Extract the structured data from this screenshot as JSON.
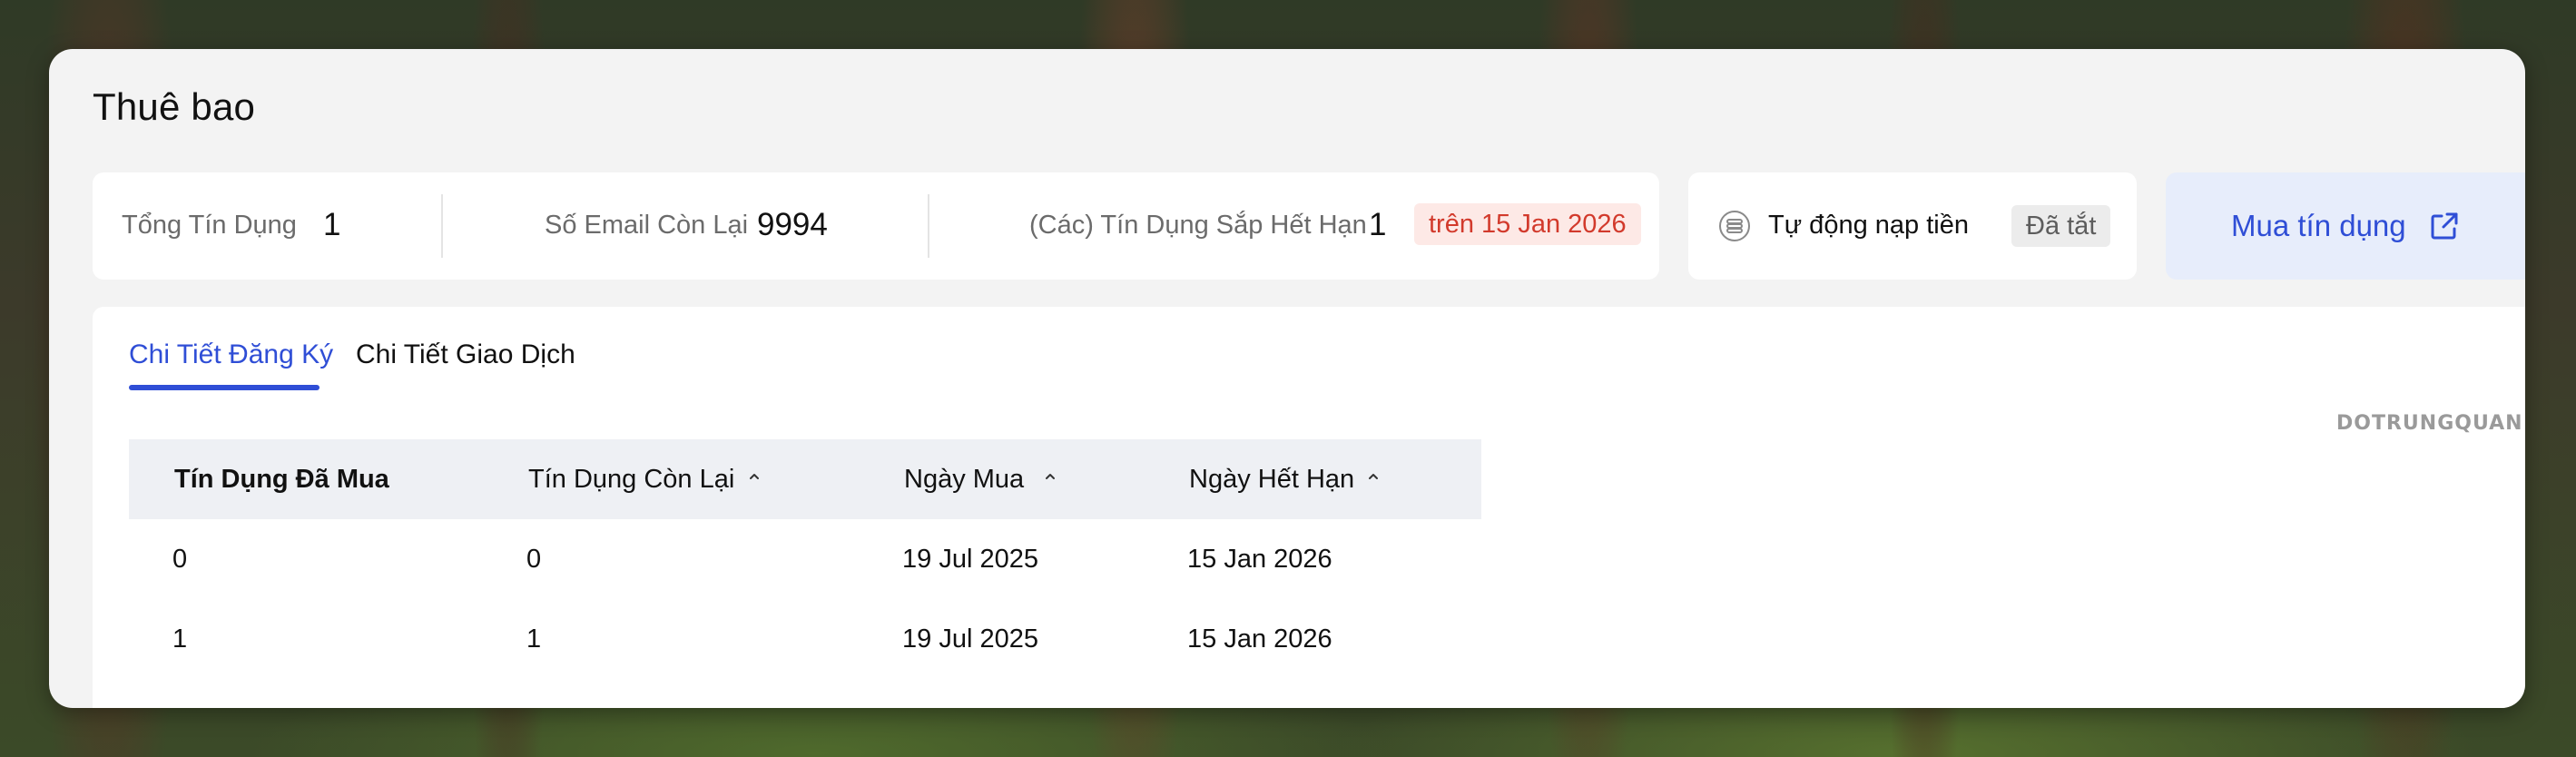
{
  "page": {
    "title": "Thuê bao"
  },
  "stats": {
    "total_credit_label": "Tổng Tín Dụng",
    "total_credit_value": "1",
    "emails_left_label": "Số Email Còn Lại",
    "emails_left_value": "9994",
    "expiring_label": "(Các) Tín Dụng Sắp Hết Hạn",
    "expiring_value": "1",
    "expiring_badge": "trên 15 Jan 2026"
  },
  "autopay": {
    "label": "Tự động nạp tiền",
    "status": "Đã tắt",
    "icon": "coins-icon"
  },
  "buy_button": {
    "label": "Mua tín dụng",
    "icon": "external-link-icon"
  },
  "tabs": [
    {
      "label": "Chi Tiết Đăng Ký",
      "active": true
    },
    {
      "label": "Chi Tiết Giao Dịch",
      "active": false
    }
  ],
  "watermark": "DOTRUNGQUAN",
  "table": {
    "columns": [
      "Tín Dụng Đã Mua",
      "Tín Dụng Còn Lại",
      "Ngày Mua",
      "Ngày Hết Hạn"
    ],
    "rows": [
      [
        "0",
        "0",
        "19 Jul 2025",
        "15 Jan 2026"
      ],
      [
        "1",
        "1",
        "19 Jul 2025",
        "15 Jan 2026"
      ]
    ]
  },
  "colors": {
    "accent": "#2f4ed6",
    "badge_bg": "#fde9e6",
    "badge_text": "#d23a2c"
  }
}
